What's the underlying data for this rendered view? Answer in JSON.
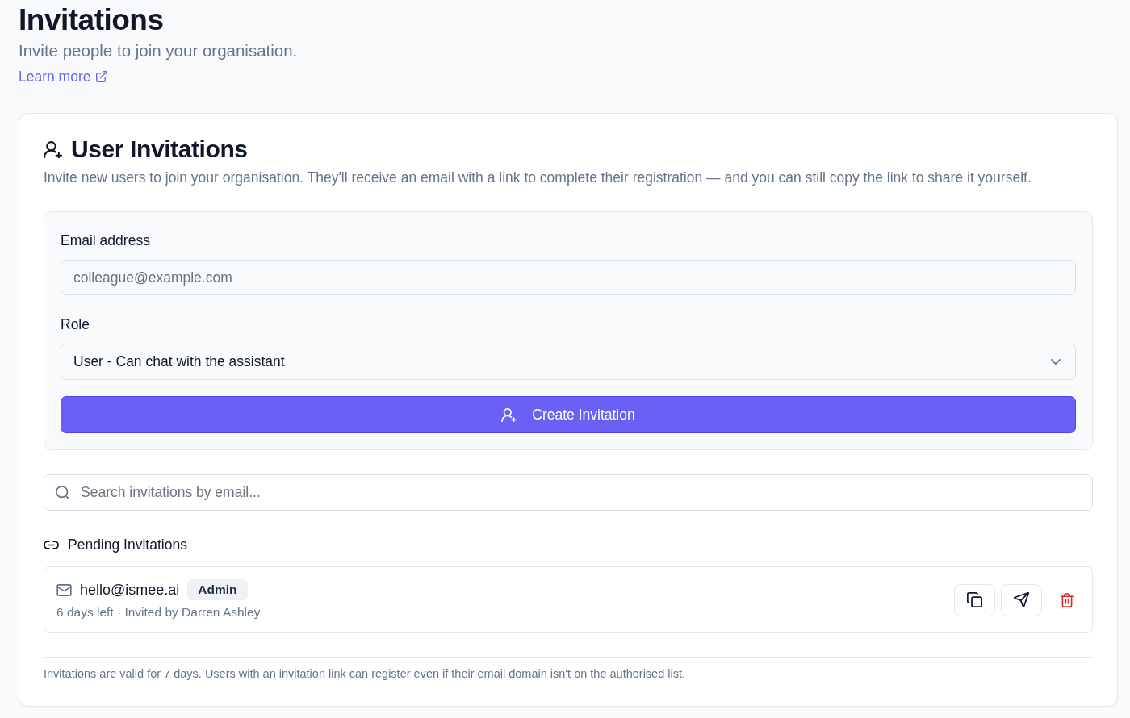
{
  "page": {
    "title": "Invitations",
    "subtitle": "Invite people to join your organisation.",
    "learn_more_link": "Learn more"
  },
  "card": {
    "title": "User Invitations",
    "description": "Invite new users to join your organisation. They'll receive an email with a link to complete their registration — and you can still copy the link to share it yourself."
  },
  "form": {
    "email": {
      "label": "Email address",
      "placeholder": "colleague@example.com"
    },
    "role": {
      "label": "Role",
      "value": "User - Can chat with the assistant"
    },
    "submit_button": "Create Invitation"
  },
  "search": {
    "placeholder": "Search invitations by email..."
  },
  "pending": {
    "title": "Pending Invitations",
    "invitations": [
      {
        "email": "hello@ismee.ai",
        "role": "Admin",
        "meta": "6 days left · Invited by Darren Ashley"
      }
    ]
  },
  "footer_note": "Invitations are valid for 7 days. Users with an invitation link can register even if their email domain isn't on the authorised list."
}
